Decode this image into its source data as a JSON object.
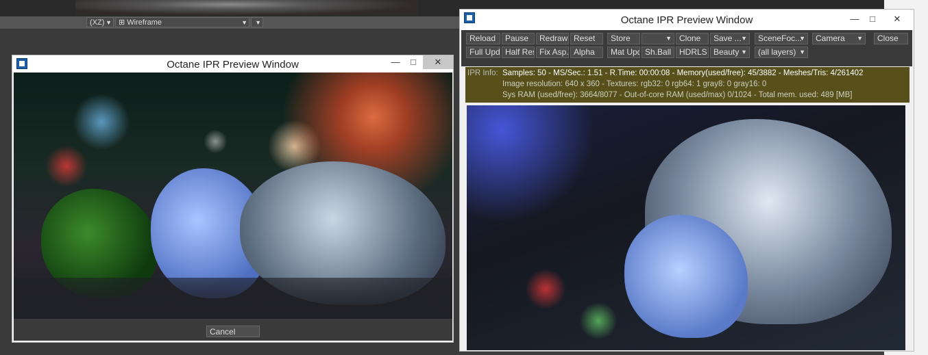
{
  "viewport": {
    "projection": "(XZ)",
    "shading": "Wireframe"
  },
  "left_window": {
    "title": "Octane IPR Preview Window",
    "cancel_label": "Cancel"
  },
  "right_window": {
    "title": "Octane IPR Preview Window",
    "toolbar_row1": [
      {
        "label": "Reload",
        "dropdown": false
      },
      {
        "label": "Pause",
        "dropdown": false
      },
      {
        "label": "Redraw",
        "dropdown": false
      },
      {
        "label": "Reset",
        "dropdown": false
      },
      {
        "label": "Store",
        "dropdown": false
      },
      {
        "label": "",
        "dropdown": true
      },
      {
        "label": "Clone",
        "dropdown": false
      },
      {
        "label": "Save ...",
        "dropdown": true
      },
      {
        "label": "SceneFoc...",
        "dropdown": true
      },
      {
        "label": "Camera",
        "dropdown": true
      },
      {
        "label": "Close",
        "dropdown": false
      }
    ],
    "toolbar_row2": [
      {
        "label": "Full Upd.",
        "dropdown": false
      },
      {
        "label": "Half Res",
        "dropdown": false
      },
      {
        "label": "Fix Asp.",
        "dropdown": false
      },
      {
        "label": "Alpha",
        "dropdown": false
      },
      {
        "label": "Mat Upd",
        "dropdown": false
      },
      {
        "label": "Sh.Ball",
        "dropdown": false
      },
      {
        "label": "HDRLS",
        "dropdown": false
      },
      {
        "label": "Beauty",
        "dropdown": true
      },
      {
        "label": "(all layers)",
        "dropdown": true
      }
    ],
    "info": {
      "label": "IPR Info:",
      "line1": "Samples: 50  -  MS/Sec.: 1.51  -  R.Time: 00:00:08 - Memory(used/free): 45/3882  -  Meshes/Tris: 4/261402",
      "line2": "Image resolution: 640 x 360  -  Textures:  rgb32: 0   rgb64: 1   gray8: 0   gray16: 0",
      "line3": "Sys RAM (used/free): 3664/8077  -  Out-of-core RAM (used/max) 0/1024  -  Total mem. used: 489  [MB]"
    }
  }
}
